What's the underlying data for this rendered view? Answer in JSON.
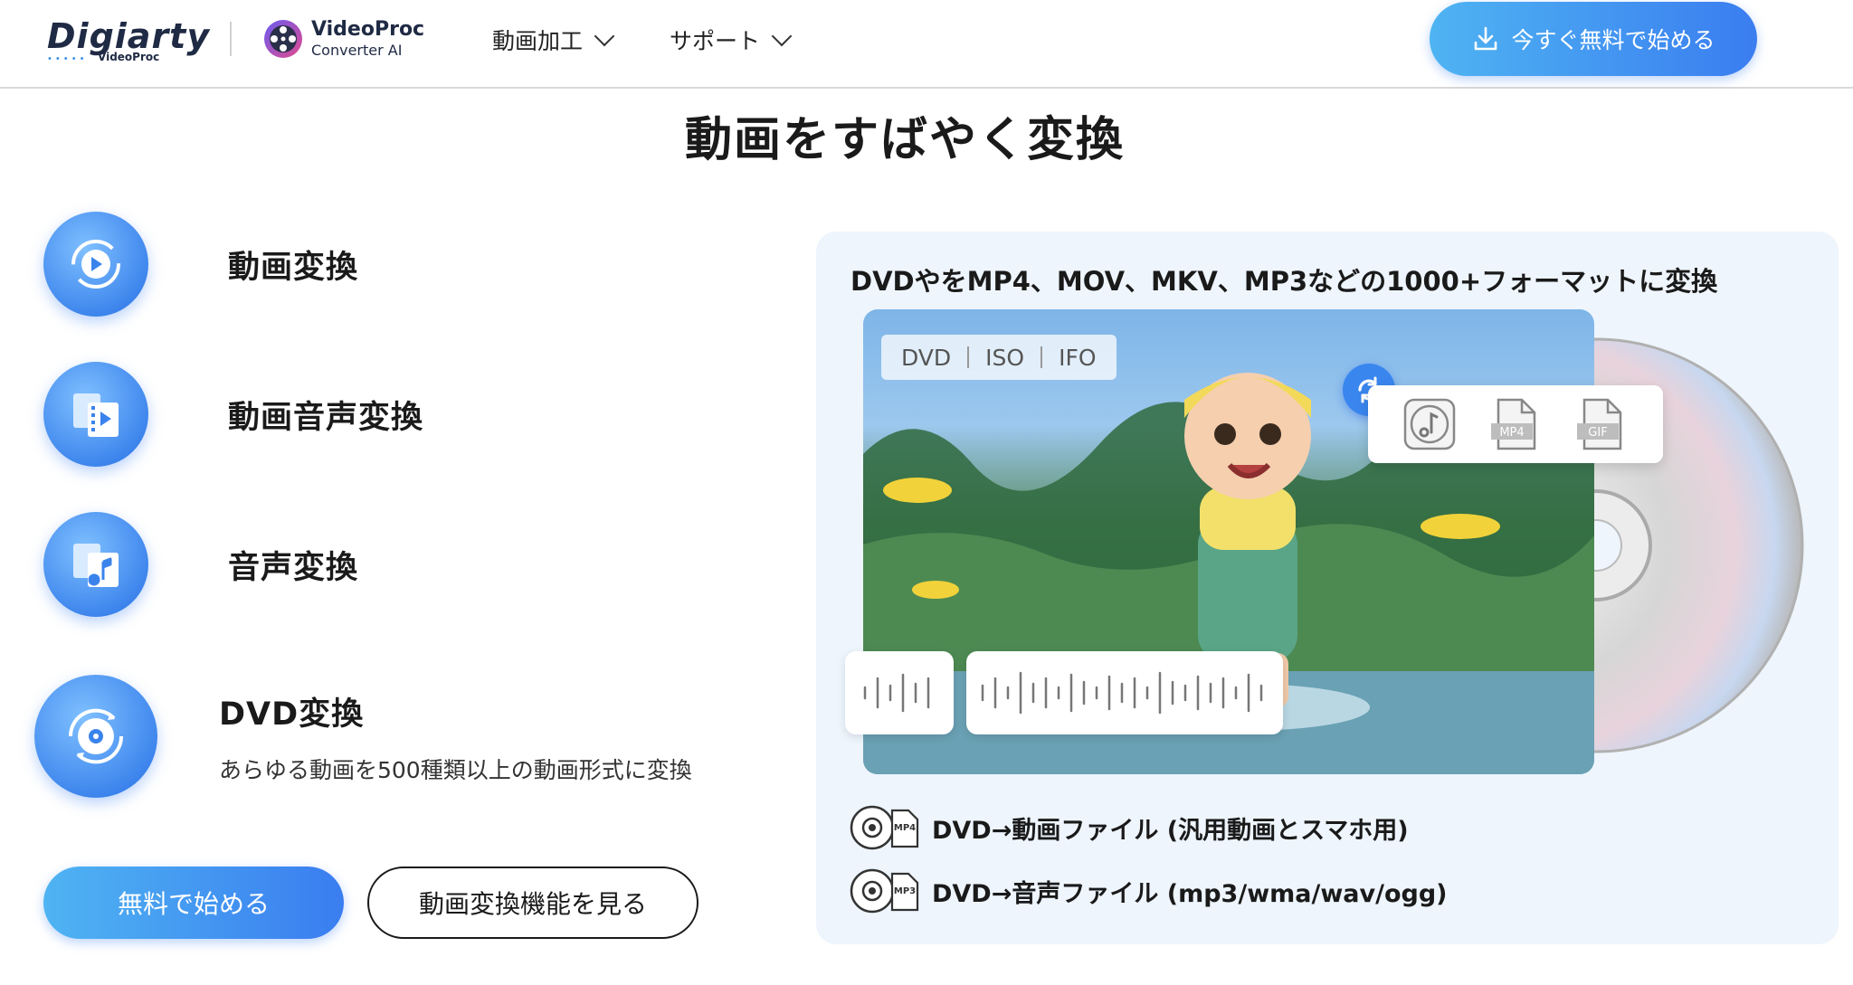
{
  "header": {
    "logo_digiarty_text": "Digiarty",
    "logo_digiarty_sub": "VideoProc",
    "logo_videoproc_line1": "VideoProc",
    "logo_videoproc_line2": "Converter AI",
    "nav": [
      {
        "label": "動画加工"
      },
      {
        "label": "サポート"
      }
    ],
    "cta_label": "今すぐ無料で始める"
  },
  "main": {
    "title": "動画をすばやく変換",
    "features": [
      {
        "label": "動画変換",
        "icon": "play-refresh-icon"
      },
      {
        "label": "動画音声変換",
        "icon": "video-audio-icon"
      },
      {
        "label": "音声変換",
        "icon": "music-note-icon"
      },
      {
        "label": "DVD変換",
        "icon": "dvd-icon",
        "description": "あらゆる動画を500種類以上の動画形式に変換"
      }
    ],
    "start_button": "無料で始める",
    "view_button": "動画変換機能を見る"
  },
  "panel": {
    "title": "DVDやをMP4、MOV、MKV、MP3などの1000+フォーマットに変換",
    "source_formats": [
      "DVD",
      "ISO",
      "IFO"
    ],
    "output_formats": [
      {
        "icon": "music-file-icon"
      },
      {
        "label": "MP4",
        "icon": "mp4-file-icon"
      },
      {
        "label": "GIF",
        "icon": "gif-file-icon"
      }
    ],
    "info_rows": [
      {
        "text": "DVD→動画ファイル (汎用動画とスマホ用)",
        "badge": "MP4"
      },
      {
        "text": "DVD→音声ファイル (mp3/wma/wav/ogg)",
        "badge": "MP3"
      }
    ]
  },
  "colors": {
    "accent_start": "#4fb4f2",
    "accent_end": "#3a7df0",
    "panel_bg": "#eef5fd"
  }
}
